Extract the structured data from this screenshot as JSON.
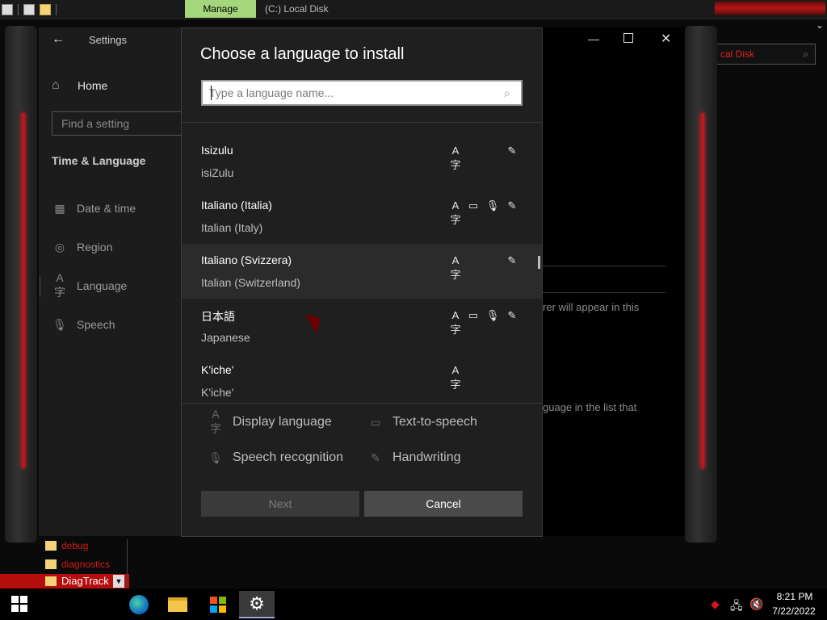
{
  "explorer": {
    "manage_tab": "Manage",
    "window_title": "(C:) Local Disk",
    "search_text": "cal Disk",
    "tree": [
      {
        "label": "debug"
      },
      {
        "label": "diagnostics"
      },
      {
        "label": "DiagTrack"
      }
    ]
  },
  "settings": {
    "title": "Settings",
    "home": "Home",
    "search_placeholder": "Find a setting",
    "section": "Time & Language",
    "nav": [
      {
        "label": "Date & time",
        "icon": "calendar-clock-icon"
      },
      {
        "label": "Region",
        "icon": "globe-icon"
      },
      {
        "label": "Language",
        "icon": "language-icon"
      },
      {
        "label": "Speech",
        "icon": "microphone-icon"
      }
    ],
    "bg_text": {
      "line1": "rer will appear in this",
      "line2": "guage in the list that"
    }
  },
  "dialog": {
    "title": "Choose a language to install",
    "search_placeholder": "Type a language name...",
    "languages": [
      {
        "name": "Isizulu",
        "native": "isiZulu",
        "features": [
          "display",
          "handwriting"
        ]
      },
      {
        "name": "Italiano (Italia)",
        "native": "Italian (Italy)",
        "features": [
          "display",
          "tts",
          "speech",
          "handwriting"
        ]
      },
      {
        "name": "Italiano (Svizzera)",
        "native": "Italian (Switzerland)",
        "features": [
          "display",
          "handwriting"
        ],
        "selected": true
      },
      {
        "name": "日本語",
        "native": "Japanese",
        "features": [
          "display",
          "tts",
          "speech",
          "handwriting"
        ]
      },
      {
        "name": "K'iche'",
        "native": "K'iche'",
        "features": [
          "display"
        ]
      }
    ],
    "legend": {
      "display": "Display language",
      "tts": "Text-to-speech",
      "speech": "Speech recognition",
      "handwriting": "Handwriting"
    },
    "next_label": "Next",
    "cancel_label": "Cancel"
  },
  "taskbar": {
    "time": "8:21 PM",
    "date": "7/22/2022"
  },
  "colors": {
    "accent_red": "#c0141c",
    "manage_tab_bg": "#a4d67c",
    "dialog_bg": "#1f1f1f"
  }
}
